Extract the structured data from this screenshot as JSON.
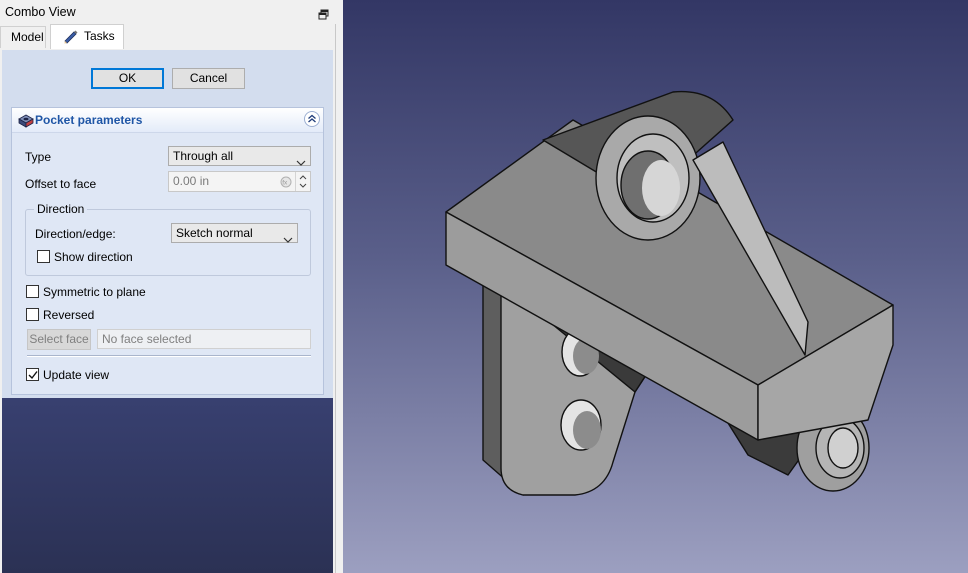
{
  "combo_view": {
    "title": "Combo View",
    "tabs": [
      {
        "label": "Model",
        "active": false
      },
      {
        "label": "Tasks",
        "active": true
      }
    ]
  },
  "task_buttons": {
    "ok": "OK",
    "cancel": "Cancel"
  },
  "pocket_parameters": {
    "title": "Pocket parameters",
    "type_label": "Type",
    "type_value": "Through all",
    "offset_label": "Offset to face",
    "offset_value": "0.00 in",
    "direction": {
      "group_title": "Direction",
      "edge_label": "Direction/edge:",
      "edge_value": "Sketch normal",
      "show_direction_label": "Show direction",
      "show_direction_checked": false
    },
    "symmetric_label": "Symmetric to plane",
    "symmetric_checked": false,
    "reversed_label": "Reversed",
    "reversed_checked": false,
    "select_face_label": "Select face",
    "face_field_value": "No face selected",
    "update_view_label": "Update view",
    "update_view_checked": true
  },
  "colors": {
    "accent": "#1f56a6",
    "viewport_top": "#333765",
    "viewport_bottom": "#9c9fc0",
    "part_fill": "#a9a9a9"
  },
  "icons": [
    "restore-window-icon",
    "pencil-icon",
    "pocket-icon",
    "collapse-icon",
    "chevron-down-icon",
    "formula-icon",
    "checkmark-icon"
  ]
}
